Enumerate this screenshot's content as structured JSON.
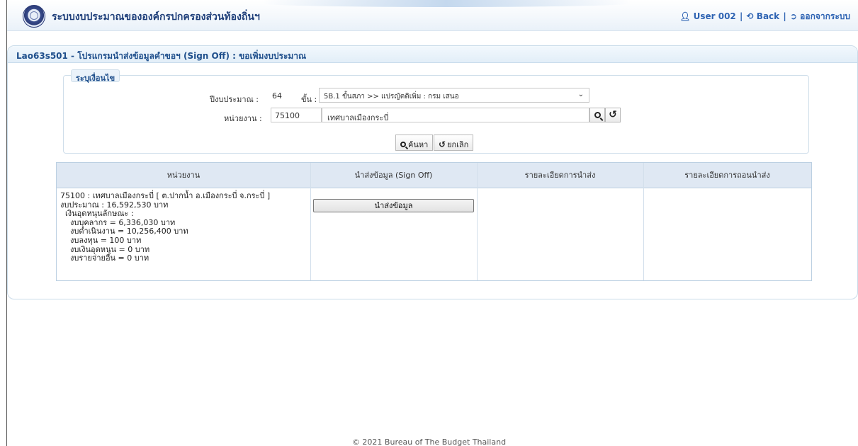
{
  "header": {
    "app_title": "ระบบงบประมาณขององค์กรปกครองส่วนท้องถิ่นฯ",
    "user_label": "User 002",
    "back_label": "Back",
    "logout_label": "ออกจากระบบ",
    "sep": "|"
  },
  "panel": {
    "title": "Lao63s501 - โปรแกรมนำส่งข้อมูลคำขอฯ (Sign Off) : ขอเพิ่มงบประมาณ"
  },
  "criteria": {
    "legend": "ระบุเงื่อนไข",
    "year_label": "ปีงบประมาณ :",
    "year_value": "64",
    "step_label": "ขั้น :",
    "step_selected": "5B.1 ขั้นสภา >> แปรญัตติเพิ่ม : กรม เสนอ",
    "unit_label": "หน่วยงาน :",
    "unit_code": "75100",
    "unit_name": "เทศบาลเมืองกระบี่",
    "search_label": "ค้นหา",
    "cancel_label": "ยกเลิก"
  },
  "table": {
    "headers": [
      "หน่วยงาน",
      "นำส่งข้อมูล (Sign Off)",
      "รายละเอียดการนำส่ง",
      "รายละเอียดการถอนนำส่ง"
    ],
    "row": {
      "unit_detail": "75100 : เทศบาลเมืองกระบี่ [ ต.ปากน้ำ อ.เมืองกระบี่ จ.กระบี่ ]\nงบประมาณ : 16,592,530 บาท\n  เงินอุดหนุนลักษณะ :\n    งบบุคลากร = 6,336,030 บาท\n    งบดำเนินงาน = 10,256,400 บาท\n    งบลงทุน = 100 บาท\n    งบเงินอุดหนุน = 0 บาท\n    งบรายจ่ายอื่น = 0 บาท",
      "send_button": "นำส่งข้อมูล"
    }
  },
  "footer": {
    "copyright": "© 2021 Bureau of The Budget Thailand"
  }
}
